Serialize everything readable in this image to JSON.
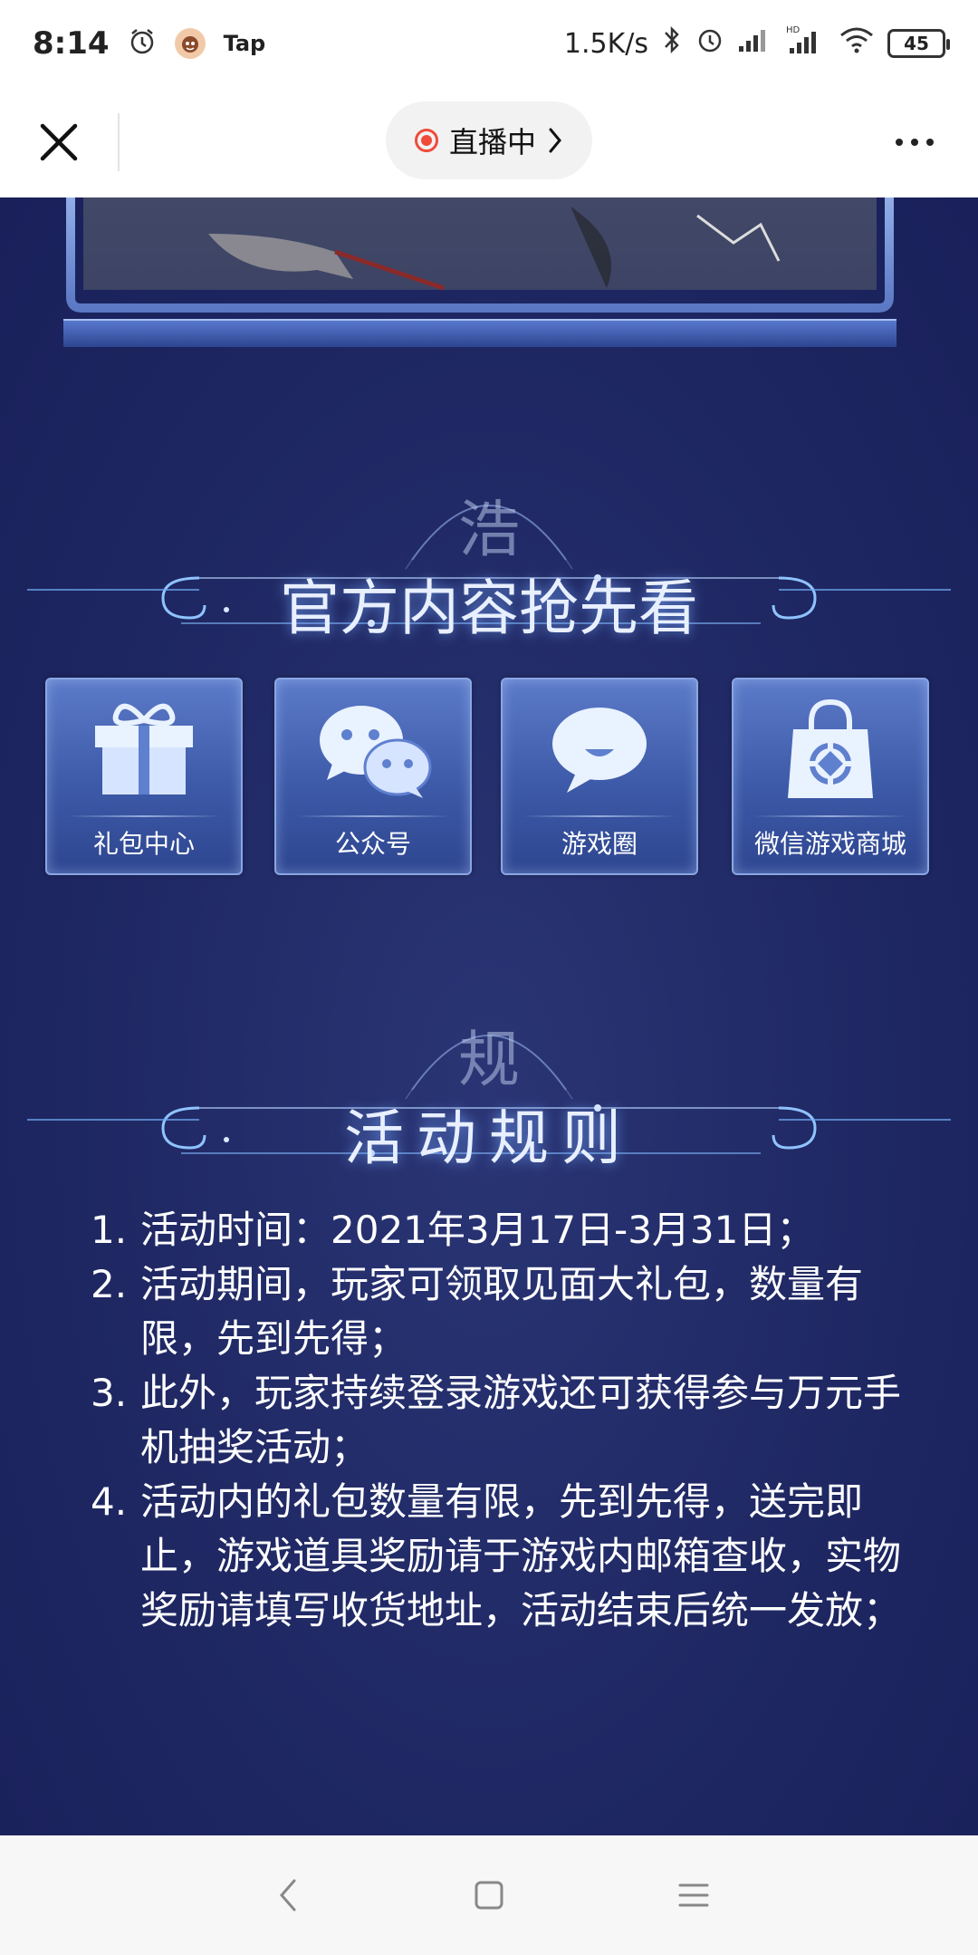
{
  "status_bar": {
    "time": "8:14",
    "app_label": "Tap",
    "network_speed": "1.5K/s",
    "battery": "45",
    "hd_label": "HD"
  },
  "top_nav": {
    "live_label": "直播中"
  },
  "sections": {
    "official_title": "官方内容抢先看",
    "official_emblem": "浩",
    "rules_title": "活动规则",
    "rules_emblem": "规"
  },
  "tiles": [
    {
      "label": "礼包中心",
      "icon": "gift-icon"
    },
    {
      "label": "公众号",
      "icon": "wechat-icon"
    },
    {
      "label": "游戏圈",
      "icon": "chat-bubble-icon"
    },
    {
      "label": "微信游戏商城",
      "icon": "shopping-bag-icon"
    }
  ],
  "rules": [
    {
      "num": "1.",
      "text": "活动时间：2021年3月17日-3月31日；"
    },
    {
      "num": "2.",
      "text": "活动期间，玩家可领取见面大礼包，数量有限，先到先得；"
    },
    {
      "num": "3.",
      "text": "此外，玩家持续登录游戏还可获得参与万元手机抽奖活动；"
    },
    {
      "num": "4.",
      "text": "活动内的礼包数量有限，先到先得，送完即止，游戏道具奖励请于游戏内邮箱查收，实物奖励请填写收货地址，活动结束后统一发放；"
    }
  ],
  "colors": {
    "background": "#1f2863",
    "tile": "#4a68b8",
    "live_dot": "#f04b3a",
    "title_glow": "#78aaff"
  }
}
